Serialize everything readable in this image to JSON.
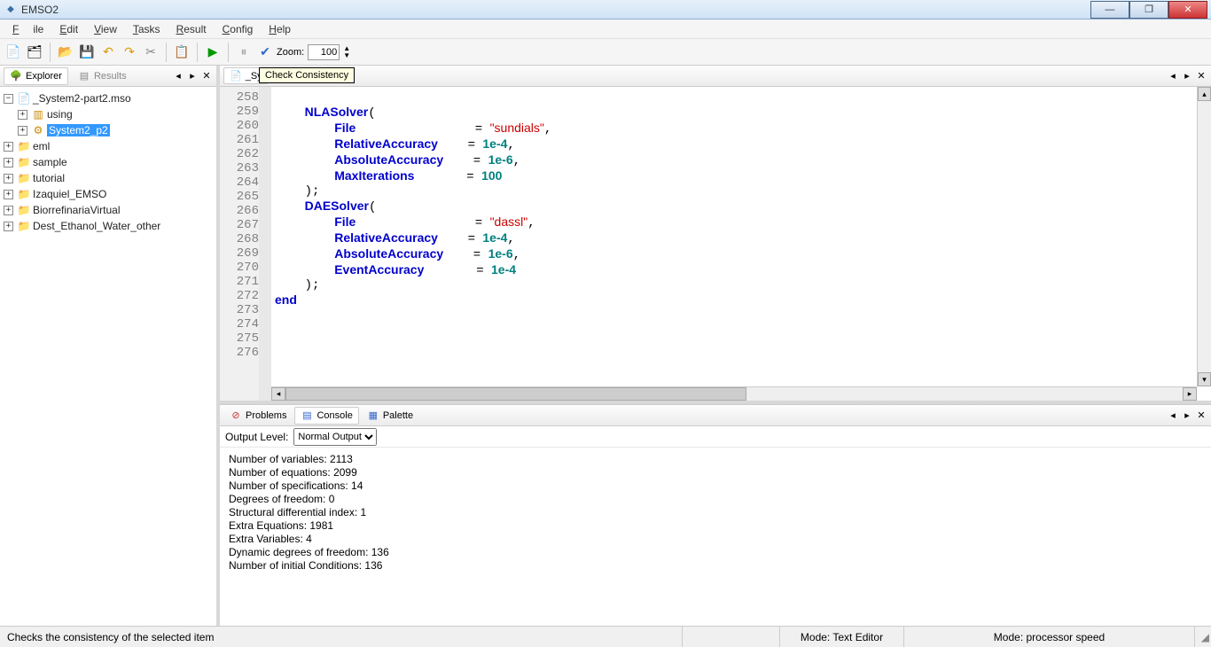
{
  "title": "EMSO2",
  "menu": {
    "file": "File",
    "edit": "Edit",
    "view": "View",
    "tasks": "Tasks",
    "result": "Result",
    "config": "Config",
    "help": "Help"
  },
  "toolbar": {
    "zoom_label": "Zoom:",
    "zoom_value": "100"
  },
  "leftTabs": {
    "explorer": "Explorer",
    "results": "Results"
  },
  "tree": {
    "root": "_System2-part2.mso",
    "using": "using",
    "system2": "System2_p2",
    "eml": "eml",
    "sample": "sample",
    "tutorial": "tutorial",
    "izaquiel": "Izaquiel_EMSO",
    "biorr": "BiorrefinariaVirtual",
    "dest": "Dest_Ethanol_Water_other"
  },
  "editor": {
    "tab": "_Sy",
    "tooltip": "Check Consistency",
    "lines": [
      258,
      259,
      260,
      261,
      262,
      263,
      264,
      265,
      266,
      267,
      268,
      269,
      270,
      271,
      272,
      273,
      274,
      275,
      276
    ]
  },
  "bottomTabs": {
    "problems": "Problems",
    "console": "Console",
    "palette": "Palette"
  },
  "output": {
    "label": "Output Level:",
    "value": "Normal Output"
  },
  "console_lines": [
    "Number of variables:  2113",
    "Number of equations:  2099",
    "Number of specifications:  14",
    "Degrees of freedom:  0",
    "Structural differential index:  1",
    "Extra Equations:    1981",
    "Extra Variables:    4",
    "Dynamic degrees of freedom:  136",
    "Number of initial Conditions: 136"
  ],
  "status": {
    "msg": "Checks the consistency of the selected item",
    "mode1": "Mode: Text Editor",
    "mode2": "Mode: processor speed"
  }
}
